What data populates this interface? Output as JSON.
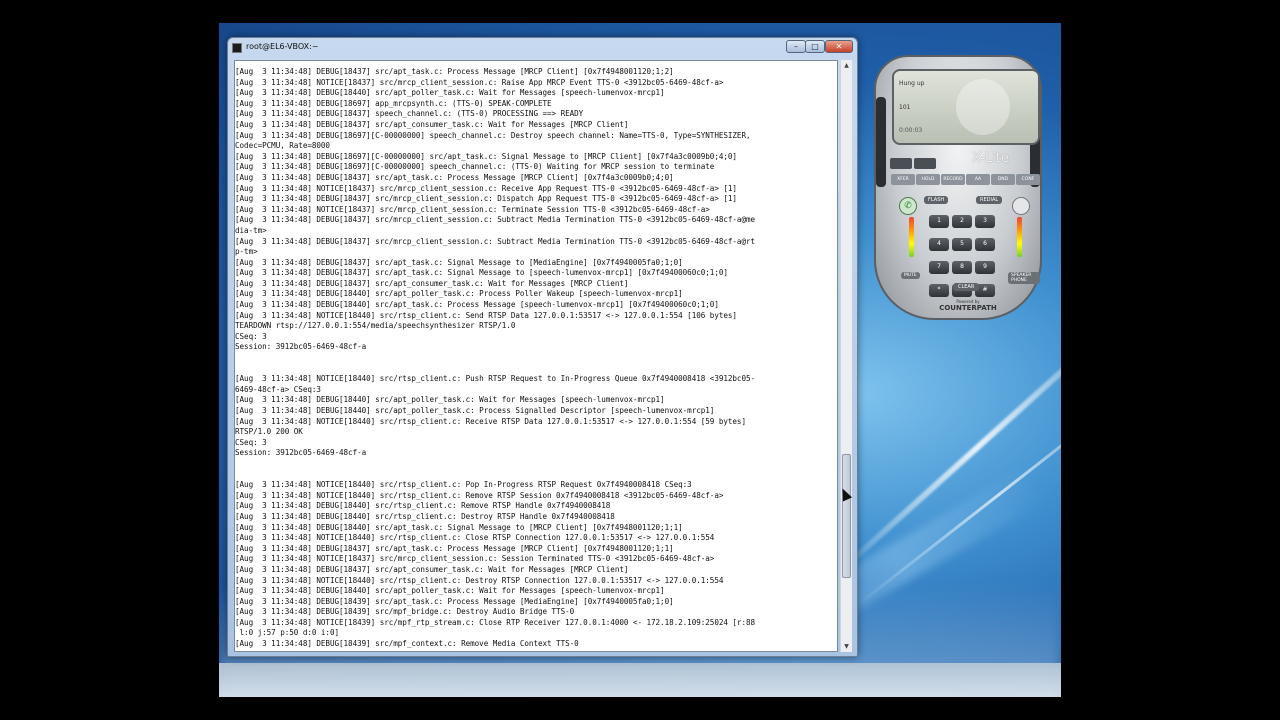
{
  "terminal": {
    "title": "root@EL6-VBOX:~",
    "buttons": {
      "minimize": "–",
      "maximize": "□",
      "close": "✕"
    },
    "lines": [
      "[Aug  3 11:34:48] DEBUG[18437] src/apt_task.c: Process Message [MRCP Client] [0x7f4948001120;1;2]",
      "[Aug  3 11:34:48] NOTICE[18437] src/mrcp_client_session.c: Raise App MRCP Event TTS-0 <3912bc05-6469-48cf-a>",
      "[Aug  3 11:34:48] DEBUG[18440] src/apt_poller_task.c: Wait for Messages [speech-lumenvox-mrcp1]",
      "[Aug  3 11:34:48] DEBUG[18697] app_mrcpsynth.c: (TTS-0) SPEAK-COMPLETE",
      "[Aug  3 11:34:48] DEBUG[18437] speech_channel.c: (TTS-0) PROCESSING ==> READY",
      "[Aug  3 11:34:48] DEBUG[18437] src/apt_consumer_task.c: Wait for Messages [MRCP Client]",
      "[Aug  3 11:34:48] DEBUG[18697][C-00000000] speech_channel.c: Destroy speech channel: Name=TTS-0, Type=SYNTHESIZER,",
      "Codec=PCMU, Rate=8000",
      "[Aug  3 11:34:48] DEBUG[18697][C-00000000] src/apt_task.c: Signal Message to [MRCP Client] [0x7f4a3c0009b0;4;0]",
      "[Aug  3 11:34:48] DEBUG[18697][C-00000000] speech_channel.c: (TTS-0) Waiting for MRCP session to terminate",
      "[Aug  3 11:34:48] DEBUG[18437] src/apt_task.c: Process Message [MRCP Client] [0x7f4a3c0009b0;4;0]",
      "[Aug  3 11:34:48] NOTICE[18437] src/mrcp_client_session.c: Receive App Request TTS-0 <3912bc05-6469-48cf-a> [1]",
      "[Aug  3 11:34:48] DEBUG[18437] src/mrcp_client_session.c: Dispatch App Request TTS-0 <3912bc05-6469-48cf-a> [1]",
      "[Aug  3 11:34:48] NOTICE[18437] src/mrcp_client_session.c: Terminate Session TTS-0 <3912bc05-6469-48cf-a>",
      "[Aug  3 11:34:48] DEBUG[18437] src/mrcp_client_session.c: Subtract Media Termination TTS-0 <3912bc05-6469-48cf-a@me",
      "dia-tm>",
      "[Aug  3 11:34:48] DEBUG[18437] src/mrcp_client_session.c: Subtract Media Termination TTS-0 <3912bc05-6469-48cf-a@rt",
      "p-tm>",
      "[Aug  3 11:34:48] DEBUG[18437] src/apt_task.c: Signal Message to [MediaEngine] [0x7f4940005fa0;1;0]",
      "[Aug  3 11:34:48] DEBUG[18437] src/apt_task.c: Signal Message to [speech-lumenvox-mrcp1] [0x7f49400060c0;1;0]",
      "[Aug  3 11:34:48] DEBUG[18437] src/apt_consumer_task.c: Wait for Messages [MRCP Client]",
      "[Aug  3 11:34:48] DEBUG[18440] src/apt_poller_task.c: Process Poller Wakeup [speech-lumenvox-mrcp1]",
      "[Aug  3 11:34:48] DEBUG[18440] src/apt_task.c: Process Message [speech-lumenvox-mrcp1] [0x7f49400060c0;1;0]",
      "[Aug  3 11:34:48] NOTICE[18440] src/rtsp_client.c: Send RTSP Data 127.0.0.1:53517 <-> 127.0.0.1:554 [106 bytes]",
      "TEARDOWN rtsp://127.0.0.1:554/media/speechsynthesizer RTSP/1.0",
      "CSeq: 3",
      "Session: 3912bc05-6469-48cf-a",
      "",
      "",
      "[Aug  3 11:34:48] NOTICE[18440] src/rtsp_client.c: Push RTSP Request to In-Progress Queue 0x7f4940008418 <3912bc05-",
      "6469-48cf-a> CSeq:3",
      "[Aug  3 11:34:48] DEBUG[18440] src/apt_poller_task.c: Wait for Messages [speech-lumenvox-mrcp1]",
      "[Aug  3 11:34:48] DEBUG[18440] src/apt_poller_task.c: Process Signalled Descriptor [speech-lumenvox-mrcp1]",
      "[Aug  3 11:34:48] NOTICE[18440] src/rtsp_client.c: Receive RTSP Data 127.0.0.1:53517 <-> 127.0.0.1:554 [59 bytes]",
      "RTSP/1.0 200 OK",
      "CSeq: 3",
      "Session: 3912bc05-6469-48cf-a",
      "",
      "",
      "[Aug  3 11:34:48] NOTICE[18440] src/rtsp_client.c: Pop In-Progress RTSP Request 0x7f4940008418 CSeq:3",
      "[Aug  3 11:34:48] NOTICE[18440] src/rtsp_client.c: Remove RTSP Session 0x7f4940008418 <3912bc05-6469-48cf-a>",
      "[Aug  3 11:34:48] DEBUG[18440] src/rtsp_client.c: Remove RTSP Handle 0x7f4940008418",
      "[Aug  3 11:34:48] DEBUG[18440] src/rtsp_client.c: Destroy RTSP Handle 0x7f4940008418",
      "[Aug  3 11:34:48] DEBUG[18440] src/apt_task.c: Signal Message to [MRCP Client] [0x7f4948001120;1;1]",
      "[Aug  3 11:34:48] NOTICE[18440] src/rtsp_client.c: Close RTSP Connection 127.0.0.1:53517 <-> 127.0.0.1:554",
      "[Aug  3 11:34:48] DEBUG[18437] src/apt_task.c: Process Message [MRCP Client] [0x7f4948001120;1;1]",
      "[Aug  3 11:34:48] NOTICE[18437] src/mrcp_client_session.c: Session Terminated TTS-0 <3912bc05-6469-48cf-a>",
      "[Aug  3 11:34:48] DEBUG[18437] src/apt_consumer_task.c: Wait for Messages [MRCP Client]",
      "[Aug  3 11:34:48] NOTICE[18440] src/rtsp_client.c: Destroy RTSP Connection 127.0.0.1:53517 <-> 127.0.0.1:554",
      "[Aug  3 11:34:48] DEBUG[18440] src/apt_poller_task.c: Wait for Messages [speech-lumenvox-mrcp1]",
      "[Aug  3 11:34:48] DEBUG[18439] src/apt_task.c: Process Message [MediaEngine] [0x7f4940005fa0;1;0]",
      "[Aug  3 11:34:48] DEBUG[18439] src/mpf_bridge.c: Destroy Audio Bridge TTS-0",
      "[Aug  3 11:34:48] NOTICE[18439] src/mpf_rtp_stream.c: Close RTP Receiver 127.0.0.1:4000 <- 172.18.2.109:25024 [r:88",
      " l:0 j:57 p:50 d:0 i:0]",
      "[Aug  3 11:34:48] DEBUG[18439] src/mpf_context.c: Remove Media Context TTS-0"
    ]
  },
  "softphone": {
    "status": "Hung up",
    "line_number": "101",
    "call_timer": "0:00:03",
    "brand": "X-Lite",
    "function_buttons": [
      "XFER",
      "HOLD",
      "RECORD",
      "AA",
      "DND",
      "CONF"
    ],
    "flash_label": "FLASH",
    "redial_label": "REDIAL",
    "keypad": [
      "1",
      "2",
      "3",
      "4",
      "5",
      "6",
      "7",
      "8",
      "9",
      "*",
      "0",
      "#"
    ],
    "mute_label": "MUTE",
    "speaker_label": "SPEAKER PHONE",
    "clear_label": "CLEAR",
    "powered_by": "Powered by",
    "vendor": "COUNTERPATH"
  }
}
